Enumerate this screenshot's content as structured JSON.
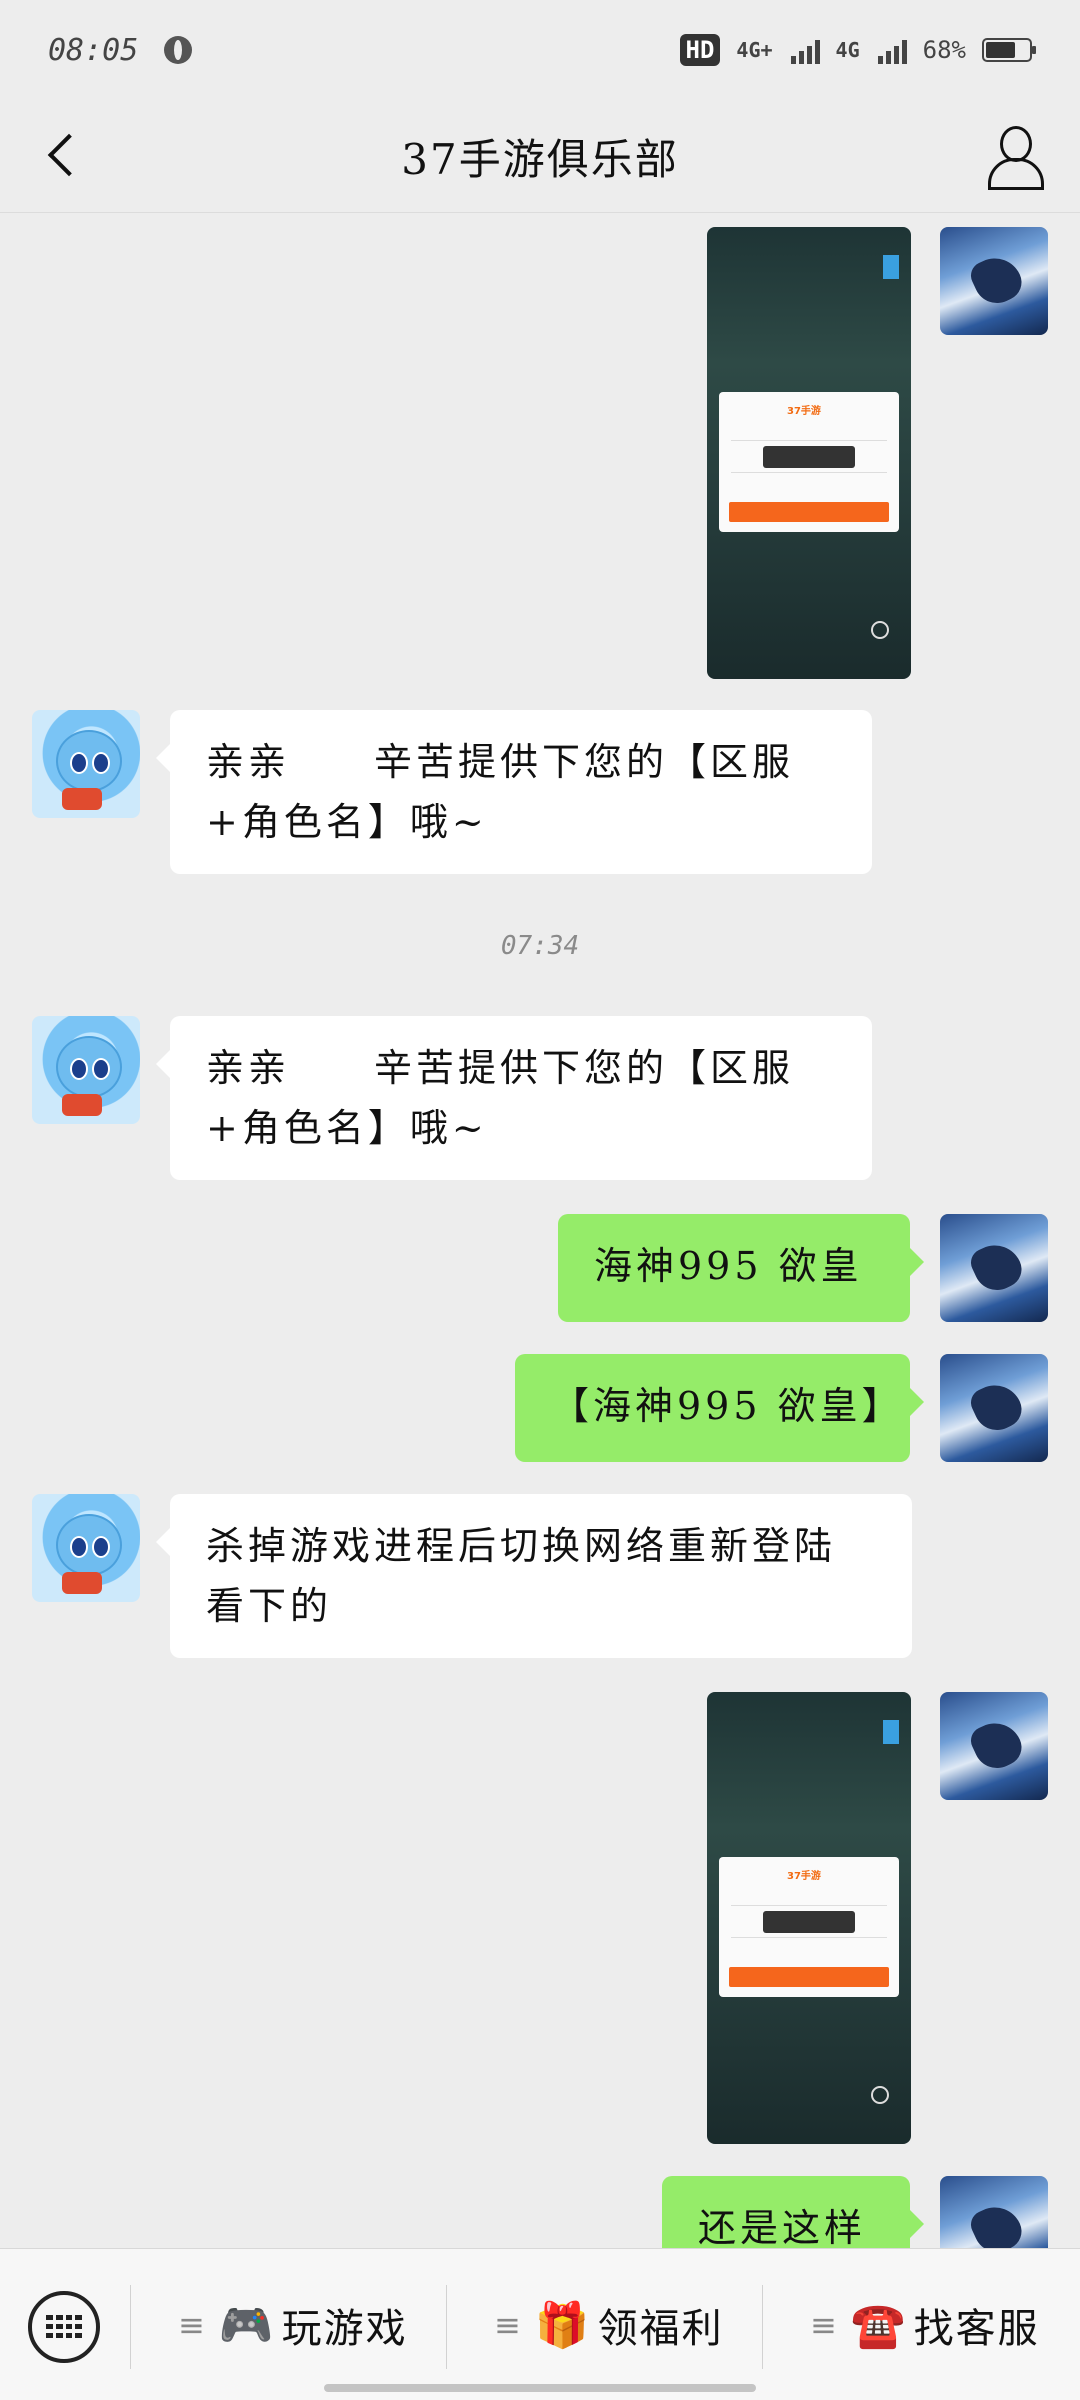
{
  "status_bar": {
    "time": "08:05",
    "hd": "HD",
    "network_1": "4G+",
    "network_2": "4G",
    "battery_percent": "68%",
    "battery_level": 0.68
  },
  "header": {
    "title": "37手游俱乐部"
  },
  "messages": {
    "m1_image": "screenshot",
    "m2_text": "亲亲　　辛苦提供下您的【区服+角色名】哦~",
    "timestamp": "07:34",
    "m3_text": "亲亲　　辛苦提供下您的【区服+角色名】哦~",
    "m4_text": "海神995  欲皇",
    "m5_text": "【海神995 欲皇】",
    "m6_text": "杀掉游戏进程后切换网络重新登陆看下的",
    "m8_text": "还是这样"
  },
  "bottom_menu": {
    "play_games": {
      "icon": "🎮",
      "label": "玩游戏"
    },
    "benefits": {
      "icon": "🎁",
      "label": "领福利"
    },
    "support": {
      "icon": "☎️",
      "label": "找客服"
    }
  },
  "colors": {
    "outgoing_bubble": "#95ec69",
    "incoming_bubble": "#ffffff",
    "background": "#ededed"
  }
}
